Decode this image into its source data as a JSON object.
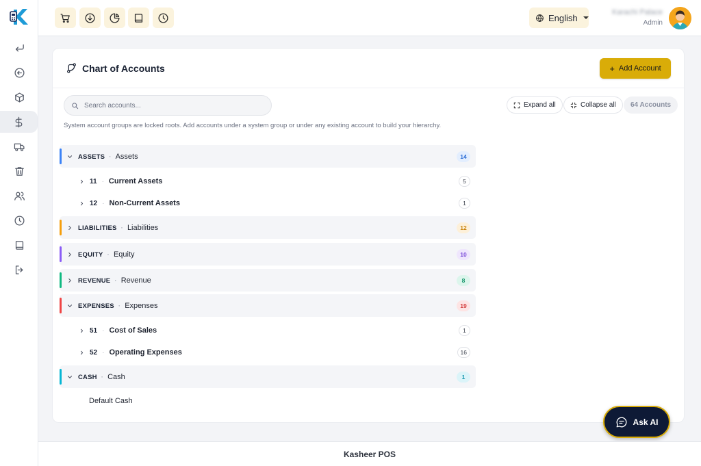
{
  "app": {
    "footer": "Kasheer POS"
  },
  "topbar": {
    "tools": [
      {
        "icon": "cart-icon"
      },
      {
        "icon": "download-icon"
      },
      {
        "icon": "pie-chart-icon"
      },
      {
        "icon": "book-icon"
      },
      {
        "icon": "clock-icon"
      }
    ],
    "language": "English",
    "user_name": "Karachi Palace",
    "user_role": "Admin"
  },
  "sidebar": {
    "items": [
      {
        "icon": "return-icon"
      },
      {
        "icon": "back-circle-icon"
      },
      {
        "icon": "box-icon"
      },
      {
        "icon": "dollar-icon",
        "active": true
      },
      {
        "icon": "truck-icon"
      },
      {
        "icon": "trash-icon"
      },
      {
        "icon": "users-icon"
      },
      {
        "icon": "clock-icon"
      },
      {
        "icon": "book-icon"
      },
      {
        "icon": "logout-icon"
      }
    ]
  },
  "page": {
    "title": "Chart of Accounts",
    "add_button": "Add Account",
    "search_placeholder": "Search accounts...",
    "expand_all": "Expand all",
    "collapse_all": "Collapse all",
    "accounts_count": "64 Accounts",
    "hint": "System account groups are locked roots. Add accounts under a system group or under any existing account to build your hierarchy."
  },
  "tree": {
    "groups": [
      {
        "code": "ASSETS",
        "name": "Assets",
        "count": "14",
        "color": "#3b82f6",
        "badge_bg": "#e3eefe",
        "badge_fg": "#2f6fd6",
        "expanded": true,
        "children": [
          {
            "code": "11",
            "name": "Current Assets",
            "count": "5"
          },
          {
            "code": "12",
            "name": "Non-Current Assets",
            "count": "1"
          }
        ]
      },
      {
        "code": "LIABILITIES",
        "name": "Liabilities",
        "count": "12",
        "color": "#f59e0b",
        "badge_bg": "#fdf0d9",
        "badge_fg": "#c9820a",
        "expanded": false
      },
      {
        "code": "EQUITY",
        "name": "Equity",
        "count": "10",
        "color": "#8b5cf6",
        "badge_bg": "#efe6fd",
        "badge_fg": "#7a4bd8",
        "expanded": false
      },
      {
        "code": "REVENUE",
        "name": "Revenue",
        "count": "8",
        "color": "#10b981",
        "badge_bg": "#dcf5ec",
        "badge_fg": "#17966b",
        "expanded": false
      },
      {
        "code": "EXPENSES",
        "name": "Expenses",
        "count": "19",
        "color": "#ef4444",
        "badge_bg": "#fde4e4",
        "badge_fg": "#d23b3b",
        "expanded": true,
        "children": [
          {
            "code": "51",
            "name": "Cost of Sales",
            "count": "1"
          },
          {
            "code": "52",
            "name": "Operating Expenses",
            "count": "16"
          }
        ]
      },
      {
        "code": "CASH",
        "name": "Cash",
        "count": "1",
        "color": "#06b6d4",
        "badge_bg": "#dbf4f9",
        "badge_fg": "#1596ae",
        "expanded": true,
        "leaf": "Default Cash"
      }
    ]
  },
  "ask_ai": "Ask AI"
}
